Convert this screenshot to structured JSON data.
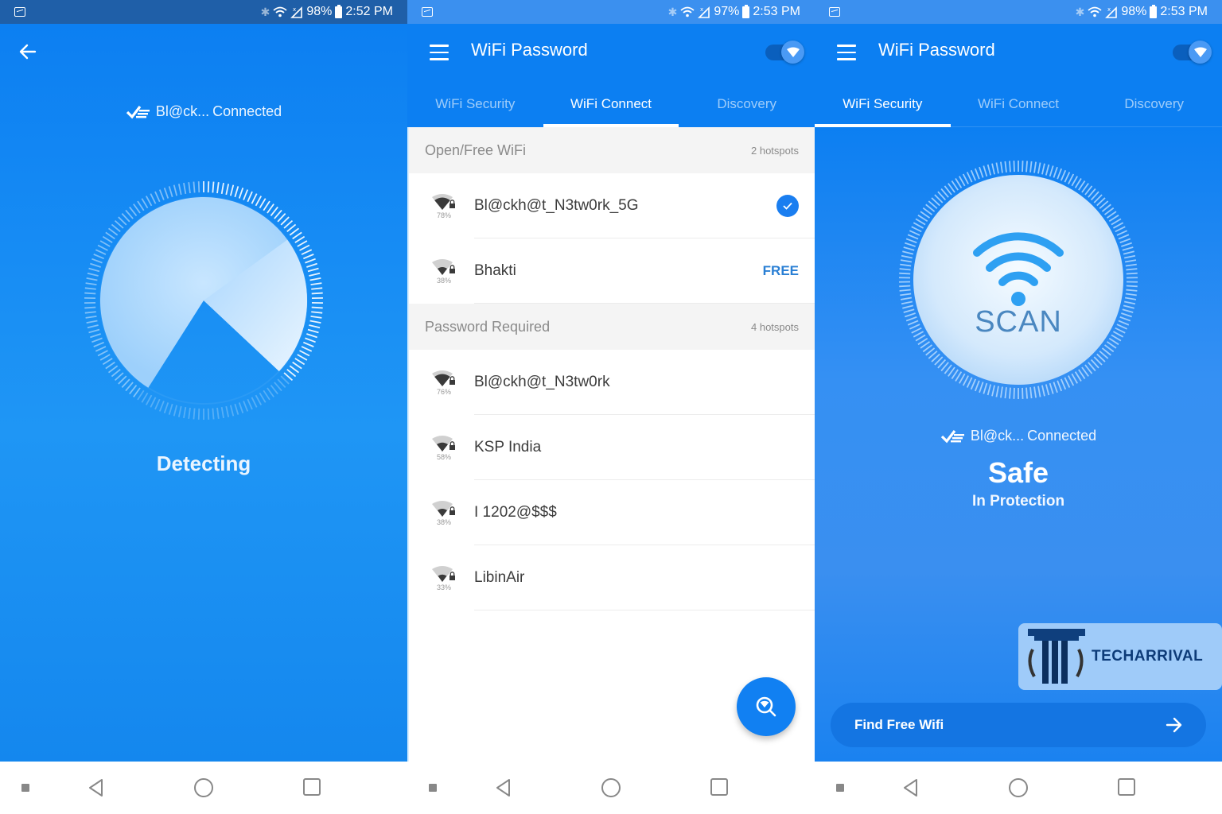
{
  "screens": [
    {
      "status": {
        "battery": "98%",
        "time": "2:52 PM"
      },
      "connection": {
        "ssid": "Bl@ck...",
        "state": "Connected"
      },
      "detecting_label": "Detecting",
      "scan_progress_fraction": 0.87
    },
    {
      "status": {
        "battery": "97%",
        "time": "2:53 PM"
      },
      "app_title": "WiFi Password",
      "toggle_on": true,
      "tabs": [
        {
          "label": "WiFi Security",
          "active": false
        },
        {
          "label": "WiFi Connect",
          "active": true
        },
        {
          "label": "Discovery",
          "active": false
        }
      ],
      "sections": [
        {
          "title": "Open/Free WiFi",
          "count": "2 hotspots",
          "networks": [
            {
              "name": "Bl@ckh@t_N3tw0rk_5G",
              "signal": "78%",
              "status": "connected"
            },
            {
              "name": "Bhakti",
              "signal": "38%",
              "status": "FREE"
            }
          ]
        },
        {
          "title": "Password Required",
          "count": "4 hotspots",
          "networks": [
            {
              "name": "Bl@ckh@t_N3tw0rk",
              "signal": "76%",
              "status": ""
            },
            {
              "name": "KSP India",
              "signal": "58%",
              "status": ""
            },
            {
              "name": "I 1202@$$$",
              "signal": "38%",
              "status": ""
            },
            {
              "name": "LibinAir",
              "signal": "33%",
              "status": ""
            }
          ]
        }
      ],
      "fab_icon": "search-wifi-icon"
    },
    {
      "status": {
        "battery": "98%",
        "time": "2:53 PM"
      },
      "app_title": "WiFi Password",
      "toggle_on": true,
      "tabs": [
        {
          "label": "WiFi Security",
          "active": true
        },
        {
          "label": "WiFi Connect",
          "active": false
        },
        {
          "label": "Discovery",
          "active": false
        }
      ],
      "scan_label": "SCAN",
      "connection": {
        "ssid": "Bl@ck...",
        "state": "Connected"
      },
      "safety_status": "Safe",
      "safety_substatus": "In Protection",
      "watermark": "TECHARRIVAL",
      "find_button_label": "Find Free Wifi"
    }
  ],
  "colors": {
    "primary": "#0c7ff2",
    "accent_text": "#2a7fd4",
    "statusbar_dark": "#1f5fa8"
  }
}
